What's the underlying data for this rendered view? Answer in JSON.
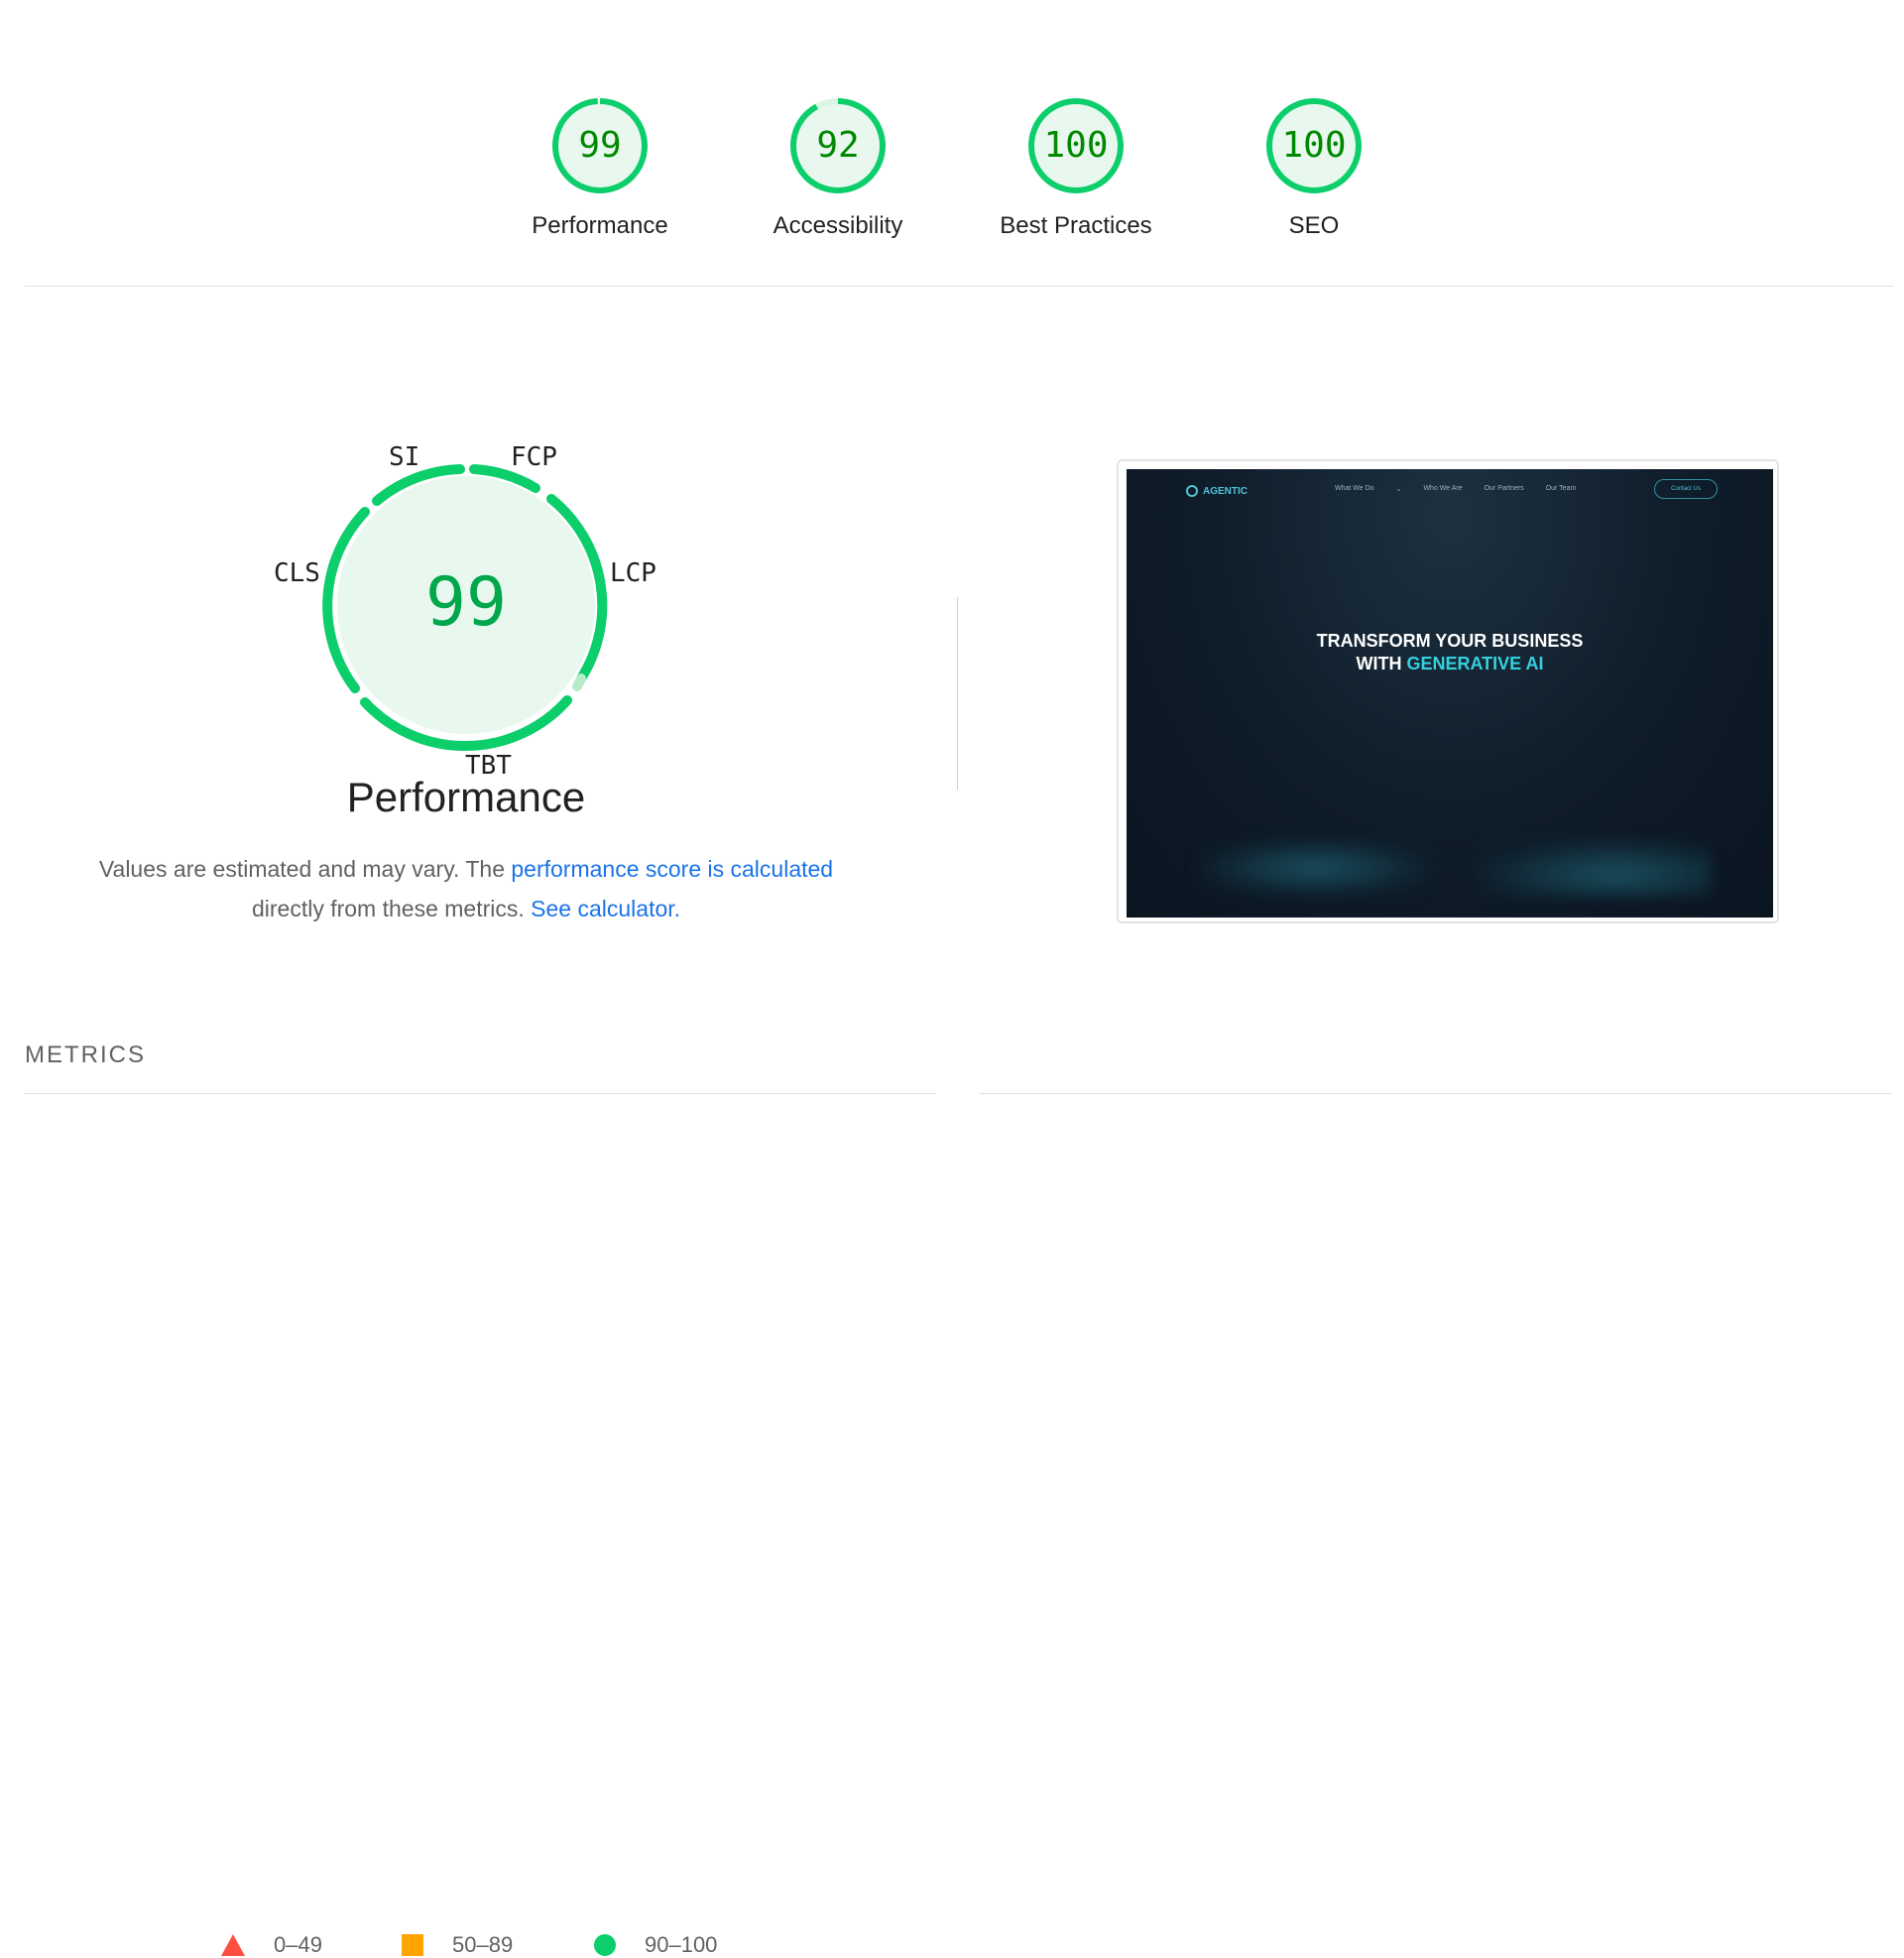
{
  "categories": [
    {
      "score": "99",
      "label": "Performance",
      "fraction": 0.99
    },
    {
      "score": "92",
      "label": "Accessibility",
      "fraction": 0.92
    },
    {
      "score": "100",
      "label": "Best Practices",
      "fraction": 1.0
    },
    {
      "score": "100",
      "label": "SEO",
      "fraction": 1.0
    }
  ],
  "performance": {
    "score": "99",
    "title": "Performance",
    "metrics": {
      "si": "SI",
      "fcp": "FCP",
      "lcp": "LCP",
      "tbt": "TBT",
      "cls": "CLS"
    },
    "description_prefix": "Values are estimated and may vary. The ",
    "description_link1": "performance score is calculated",
    "description_middle": " directly from these metrics. ",
    "description_link2": "See calculator."
  },
  "legend": [
    {
      "range": "0–49",
      "shape": "triangle",
      "color": "#ff4e42"
    },
    {
      "range": "50–89",
      "shape": "square",
      "color": "#ffa400"
    },
    {
      "range": "90–100",
      "shape": "circle",
      "color": "#0cce6b"
    }
  ],
  "metrics_header": "METRICS",
  "thumbnail": {
    "logo": "AGENTIC",
    "nav": [
      "What We Do",
      "⌄",
      "Who We Are",
      "Our Partners",
      "Our Team"
    ],
    "contact": "Contact Us",
    "headline_line1": "TRANSFORM YOUR BUSINESS",
    "headline_line2_prefix": "WITH ",
    "headline_line2_accent": "GENERATIVE AI"
  },
  "colors": {
    "pass": "#0cce6b",
    "pass_dark": "#008800",
    "pass_bg": "#e8f8ee",
    "link": "#1a73e8"
  }
}
